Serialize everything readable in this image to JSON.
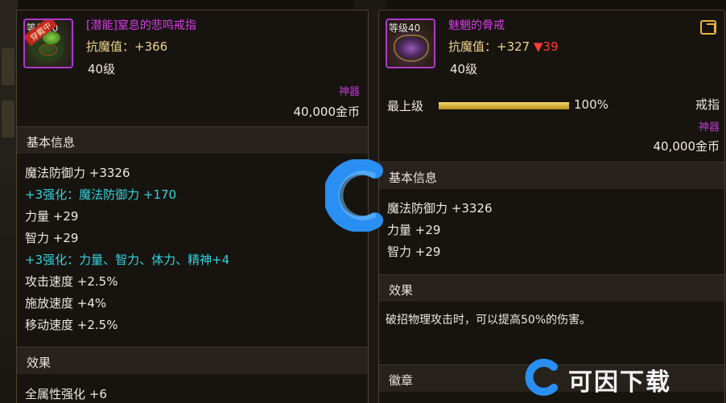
{
  "left_item": {
    "level_tag": "等级40",
    "equipped_badge": "穿戴中",
    "name": "[潜能]窒息的悲鸣戒指",
    "magic_resist": "抗魔值：+366",
    "level": "40级",
    "rarity": "神器",
    "price": "40,000金币",
    "basic_info_title": "基本信息",
    "attributes": [
      {
        "text": "魔法防御力 +3326",
        "color": "white"
      },
      {
        "text": "+3强化：魔法防御力 +170",
        "color": "cyan"
      },
      {
        "text": "力量 +29",
        "color": "white"
      },
      {
        "text": "智力 +29",
        "color": "white"
      },
      {
        "text": "+3强化：力量、智力、体力、精神+4",
        "color": "cyan"
      },
      {
        "text": "攻击速度 +2.5%",
        "color": "white"
      },
      {
        "text": "施放速度 +4%",
        "color": "white"
      },
      {
        "text": "移动速度 +2.5%",
        "color": "white"
      }
    ],
    "effect_title": "效果",
    "effect_text": "全属性强化 +6"
  },
  "right_item": {
    "level_tag": "等级40",
    "name": "魅魍的骨戒",
    "magic_resist": "抗魔值：+327",
    "resist_diff": "▼39",
    "level": "40级",
    "grade_label": "最上级",
    "grade_percent": "100%",
    "grade_fraction": 1.0,
    "type": "戒指",
    "rarity": "神器",
    "price": "40,000金币",
    "basic_info_title": "基本信息",
    "attributes": [
      {
        "text": "魔法防御力 +3326"
      },
      {
        "text": "力量 +29"
      },
      {
        "text": "智力 +29"
      }
    ],
    "effect_title": "效果",
    "effect_text": "破招物理攻击时，可以提高50%的伤害。",
    "emblem_title": "徽章",
    "share_icon": "share-icon"
  },
  "watermark": {
    "text": "可因下载",
    "accent": "#1e8cf0"
  }
}
